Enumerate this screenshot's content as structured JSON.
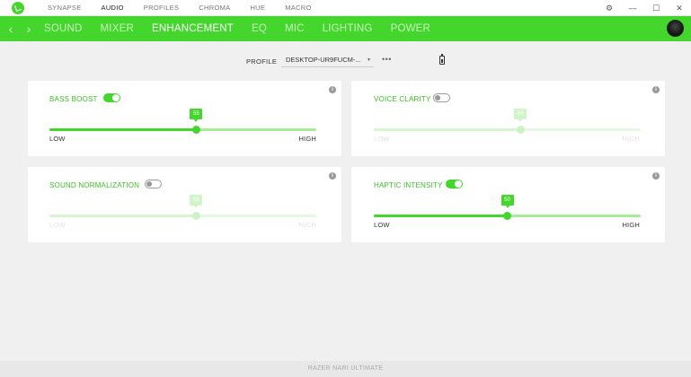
{
  "app": {
    "top_nav": [
      "SYNAPSE",
      "AUDIO",
      "PROFILES",
      "CHROMA",
      "HUE",
      "MACRO"
    ],
    "active_top": "AUDIO",
    "window_controls": [
      "⚙",
      "—",
      "☐",
      "✕"
    ]
  },
  "subnav": {
    "items": [
      "SOUND",
      "MIXER",
      "ENHANCEMENT",
      "EQ",
      "MIC",
      "LIGHTING",
      "POWER"
    ],
    "active": "ENHANCEMENT",
    "back": "‹",
    "forward": "›"
  },
  "profile": {
    "label": "PROFILE",
    "value": "DESKTOP-UR9FUCM-...",
    "caret": "▾",
    "more": "•••"
  },
  "cards": {
    "bass_boost": {
      "title": "BASS BOOST",
      "enabled": true,
      "value": 55,
      "value_text": "55",
      "low": "LOW",
      "high": "HIGH"
    },
    "voice_clarity": {
      "title": "VOICE CLARITY",
      "enabled": false,
      "value": 55,
      "value_text": "55",
      "low": "LOW",
      "high": "HIGH"
    },
    "sound_normalization": {
      "title": "SOUND NORMALIZATION",
      "enabled": false,
      "value": 55,
      "value_text": "55",
      "low": "LOW",
      "high": "HIGH"
    },
    "haptic_intensity": {
      "title": "HAPTIC INTENSITY",
      "enabled": true,
      "value": 50,
      "value_text": "50",
      "low": "LOW",
      "high": "HIGH"
    }
  },
  "info_glyph": "i",
  "footer": {
    "device": "RAZER NARI ULTIMATE"
  },
  "colors": {
    "accent": "#44d62c",
    "background": "#f0f0f0",
    "card": "#ffffff"
  }
}
